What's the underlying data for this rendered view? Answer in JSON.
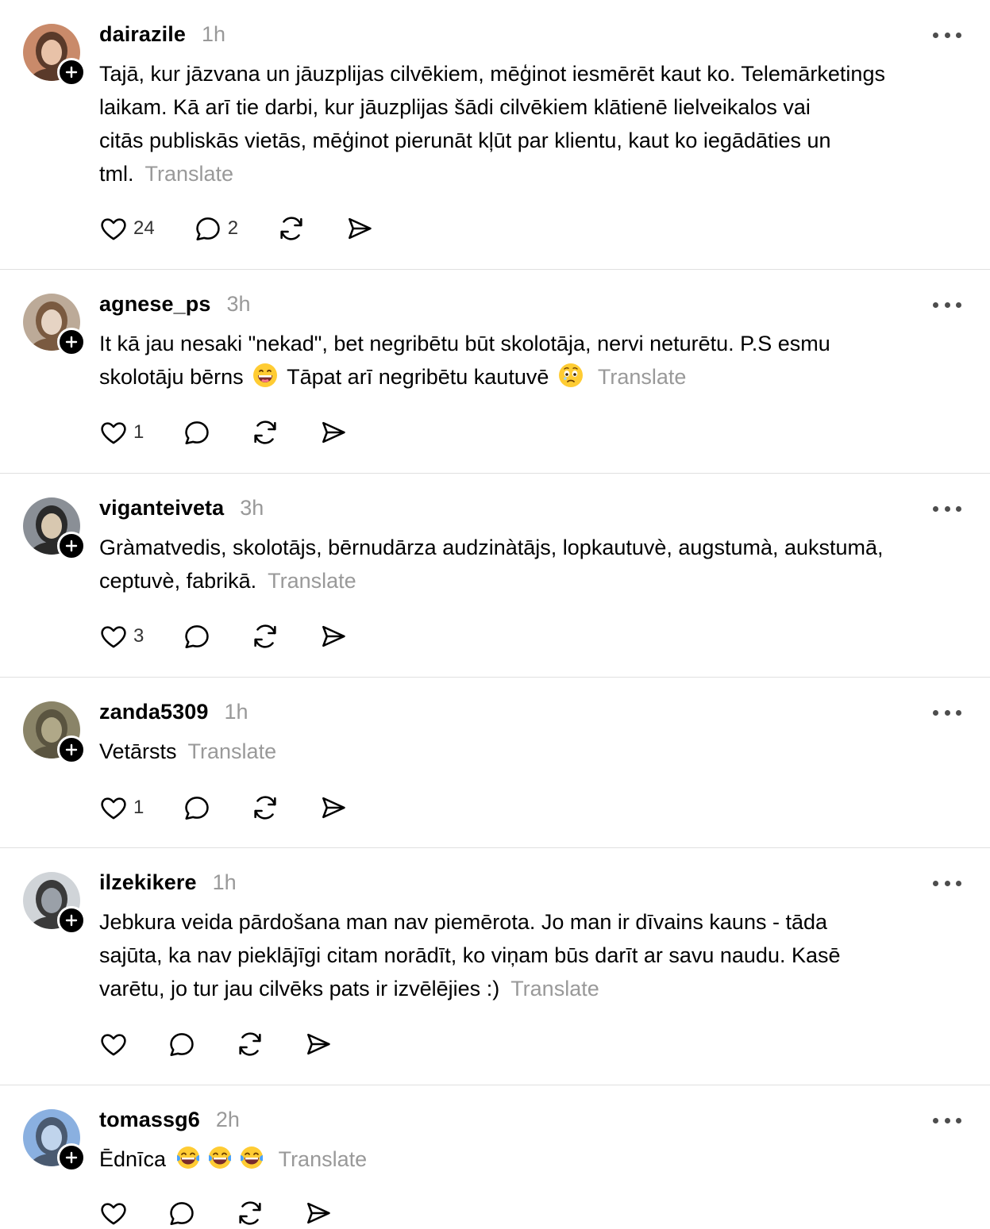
{
  "translate_label": "Translate",
  "posts": [
    {
      "username": "dairazile",
      "time": "1h",
      "text": "Tajā, kur jāzvana un jāuzplijas cilvēkiem, mēģinot iesmērēt kaut ko. Telemārketings\nlaikam. Kā arī tie darbi, kur jāuzplijas šādi cilvēkiem klātienē lielveikalos vai\ncitās publiskās vietās, mēģinot pierunāt kļūt par klientu, kaut ko iegādāties un\ntml.",
      "likes": "24",
      "replies": "2",
      "emojis": [],
      "avatar_colors": [
        "#c98a6a",
        "#5a3a2a",
        "#e8c2a8"
      ]
    },
    {
      "username": "agnese_ps",
      "time": "3h",
      "text": "It kā jau nesaki \"nekad\", bet negribētu būt skolotāja, nervi neturētu. P.S esmu\nskolotāju bērns",
      "text2": "Tāpat arī negribētu kautuvē",
      "likes": "1",
      "replies": "",
      "emojis": [
        "grin-emoji",
        "woozy-emoji"
      ],
      "avatar_colors": [
        "#bcaa98",
        "#7a5a40",
        "#e6d4c4"
      ]
    },
    {
      "username": "viganteiveta",
      "time": "3h",
      "text": "Gràmatvedis, skolotājs, bērnudārza audzinàtājs, lopkautuvè, augstumà, aukstumā,\nceptuvè, fabrikā.",
      "likes": "3",
      "replies": "",
      "emojis": [],
      "avatar_colors": [
        "#8a8f96",
        "#2a2a2a",
        "#d8c8b0"
      ]
    },
    {
      "username": "zanda5309",
      "time": "1h",
      "text": "Vetārsts",
      "likes": "1",
      "replies": "",
      "emojis": [],
      "avatar_colors": [
        "#8a8468",
        "#5a5440",
        "#b0a888"
      ]
    },
    {
      "username": "ilzekikere",
      "time": "1h",
      "text": "Jebkura veida pārdošana man nav piemērota. Jo man ir dīvains kauns - tāda\nsajūta, ka nav pieklājīgi citam norādīt, ko viņam būs darīt ar savu naudu. Kasē\nvarētu, jo tur jau cilvēks pats ir izvēlējies :)",
      "likes": "",
      "replies": "",
      "emojis": [],
      "avatar_colors": [
        "#d0d4d8",
        "#3a3a3a",
        "#9aa0a8"
      ]
    },
    {
      "username": "tomassg6",
      "time": "2h",
      "text": "Ēdnīca",
      "likes": "",
      "replies": "",
      "emojis": [
        "joy-emoji",
        "joy-emoji",
        "joy-emoji"
      ],
      "avatar_colors": [
        "#8ab0e0",
        "#4a5a70",
        "#c0d4ec"
      ]
    }
  ]
}
